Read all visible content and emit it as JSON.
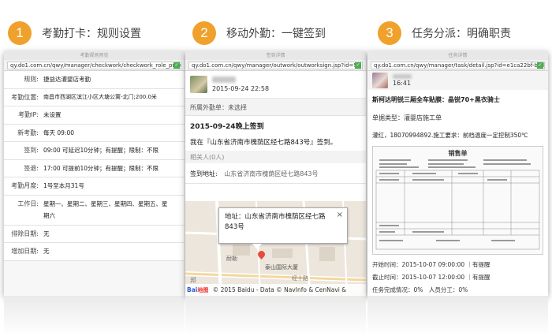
{
  "steps": [
    {
      "num": "1",
      "title": "考勤打卡：规则设置"
    },
    {
      "num": "2",
      "title": "移动外勤：一键签到"
    },
    {
      "num": "3",
      "title": "任务分派：明确职责"
    }
  ],
  "colors": {
    "accent": "#f0a12b",
    "link": "#1a5fb4",
    "red": "#c00000"
  },
  "p1": {
    "tab": "考勤规则预览",
    "url": "qy.do1.com.cn/qwy/manager/checkwork/checkwork_role_preview.js",
    "rows": [
      {
        "label": "规则:",
        "value": "捷益达灌婴店考勤"
      },
      {
        "label": "考勤位置:",
        "value": "南昌市西湖区滨江小区大塘公寓-北门;200.0米"
      },
      {
        "label": "考勤IP:",
        "value": "未设置"
      },
      {
        "label": "新考勤:",
        "value": "每天 09:00"
      },
      {
        "label": "签到:",
        "value": "09:00 可延迟10分钟；有提醒；限制：不限"
      },
      {
        "label": "签退:",
        "value": "17:00 可提前10分钟；有提醒；限制：不限"
      },
      {
        "label": "考勤月度:",
        "value": "1号至本月31号"
      },
      {
        "label": "工作日:",
        "value": "星期一、星期二、星期三、星期四、星期五、星期六"
      },
      {
        "label": "排除日期:",
        "value": "无"
      },
      {
        "label": "增加日期:",
        "value": "无"
      }
    ]
  },
  "p2": {
    "tab": "签到详情",
    "url": "qy.do1.com.cn/qwy/manager/outwork/outworksign.jsp?id=9i",
    "time": "2015-09-24 22:58",
    "unit": "所属外勤单：未选择",
    "heading": "2015-09-24晚上签到",
    "body": "我在『山东省济南市槐荫区经七路843号』签到。",
    "related": "相关人(0人)",
    "sign_label": "签到地址:",
    "sign_addr": "山东省济南市槐荫区经七路843号",
    "popup": "地址：山东省济南市槐荫区经七路843号",
    "popup_close": "×",
    "map_labels": {
      "a": "耐勒",
      "b": "泰山国际大厦",
      "c": "经十路",
      "d": "邦"
    },
    "footer": "© 2015 Baidu - Data © NavInfo & CenNavi &",
    "baidu": "Bai",
    "baidu2": "地图"
  },
  "p3": {
    "tab": "任务详情",
    "url": "qy.do1.com.cn/qwy/manager/task/detail.jsp?id=e1ca22bf-bcd8-45t",
    "time": "16:41",
    "title": "斯柯达明锐三厢全车贴膜：晶锐70+黑衣骑士",
    "type": "单据类型：灌婴店施工单",
    "desc": "灌红，18070994892.施工要求：前档温度一定控制350℃",
    "doc_title": "销售单",
    "start": "开始时间：2015-10-07 09:00:00 ｜有提醒",
    "end": "截止时间：2015-10-07 12:00:00 ｜有提醒",
    "progress": "任务完成情况：0%　人员分工：0%"
  }
}
